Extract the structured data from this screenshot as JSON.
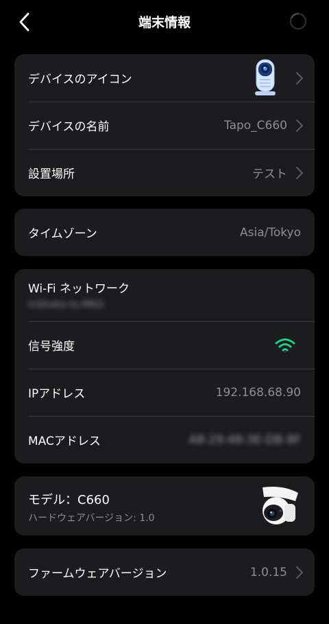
{
  "header": {
    "title": "端末情報"
  },
  "device": {
    "icon_label": "デバイスのアイコン",
    "name_label": "デバイスの名前",
    "name_value": "Tapo_C660",
    "location_label": "設置場所",
    "location_value": "テスト"
  },
  "timezone": {
    "label": "タイムゾーン",
    "value": "Asia/Tokyo"
  },
  "network": {
    "wifi_label": "Wi-Fi ネットワーク",
    "wifi_ssid": "InShoko-ts-MKG",
    "signal_label": "信号強度",
    "ip_label": "IPアドレス",
    "ip_value": "192.168.68.90",
    "mac_label": "MACアドレス",
    "mac_value": "A8-29-48-3E-DB-8F",
    "signal_color": "#1fcf84"
  },
  "model": {
    "label": "モデル：C660",
    "hardware": "ハードウェアバージョン: 1.0"
  },
  "firmware": {
    "label": "ファームウェアバージョン",
    "value": "1.0.15"
  }
}
